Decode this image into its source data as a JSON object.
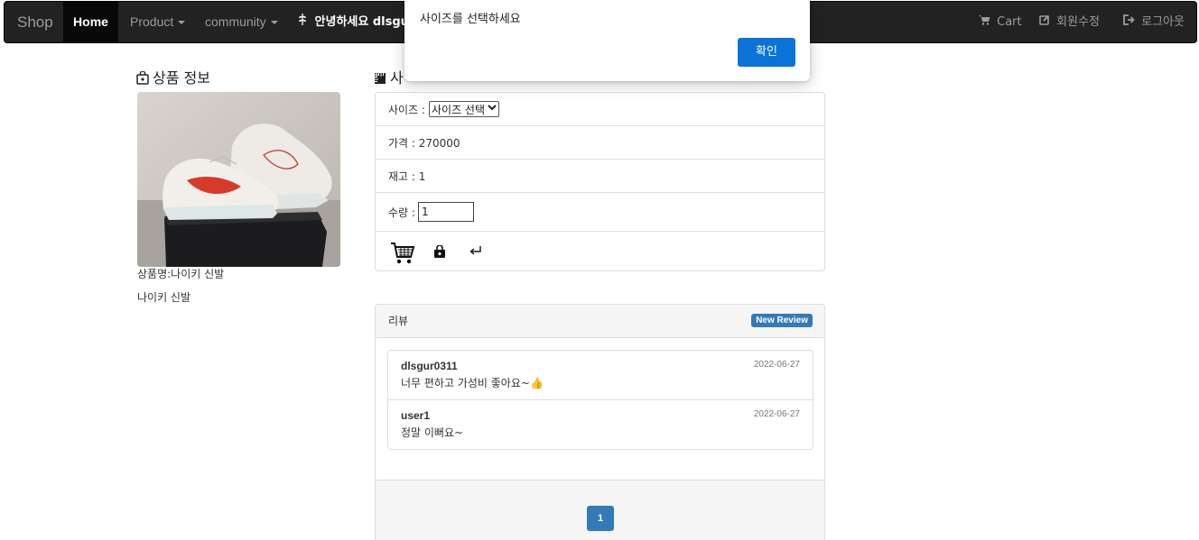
{
  "navbar": {
    "brand": "Shop",
    "home": "Home",
    "product": "Product",
    "community": "community",
    "greeting": "안녕하세요 dlsgur0",
    "cart": "Cart",
    "edit_member": "회원수정",
    "logout": "로그아웃"
  },
  "alert": {
    "message": "사이즈를 선택하세요",
    "ok_label": "확인"
  },
  "product": {
    "section_title": "상품 정보",
    "name_line": "상품명:나이키 신발",
    "description": "나이키 신발"
  },
  "options": {
    "section_title": "사",
    "size_label": "사이즈 :",
    "size_selected": "사이즈 선택",
    "price_line": "가격 : 270000",
    "stock_line": "재고 : 1",
    "qty_label": "수량 :",
    "qty_value": "1"
  },
  "reviews": {
    "title": "리뷰",
    "new_review_label": "New Review",
    "items": [
      {
        "user": "dlsgur0311",
        "date": "2022-06-27",
        "text": "너무 편하고 가성비 좋아요~👍"
      },
      {
        "user": "user1",
        "date": "2022-06-27",
        "text": "정말 이뻐요~"
      }
    ],
    "current_page": "1"
  },
  "colors": {
    "navbar_bg": "#222222",
    "alert_button": "#0b73d8",
    "primary": "#337ab7"
  }
}
